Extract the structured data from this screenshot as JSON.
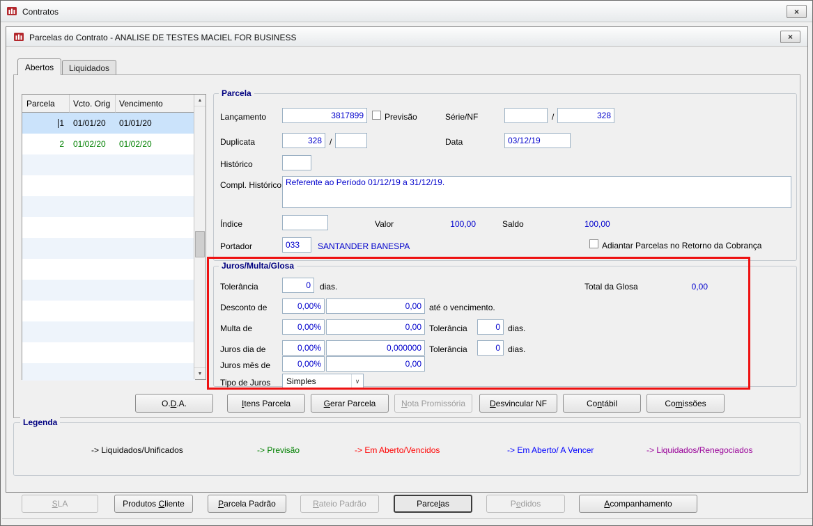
{
  "icons": {
    "close": "×",
    "scroll_up": "▲",
    "scroll_down": "▼",
    "combo_arrow": "∨"
  },
  "colors": {
    "field_value_text": "#0000cc",
    "selected_row_bg": "#cbe3fb",
    "annotation_red": "#ee1111",
    "group_title": "#000080"
  },
  "outer_window": {
    "title": "Contratos"
  },
  "inner_window": {
    "title": "Parcelas do Contrato - ANALISE DE TESTES MACIEL FOR BUSINESS"
  },
  "tabs": [
    {
      "label": "Abertos"
    },
    {
      "label": "Liquidados"
    }
  ],
  "grid": {
    "headers": [
      "Parcela",
      "Vcto. Orig",
      "Vencimento"
    ],
    "rows": [
      {
        "parcela": "1",
        "vcto_orig": "01/01/20",
        "vencimento": "01/01/20",
        "state": "selected"
      },
      {
        "parcela": "2",
        "vcto_orig": "01/02/20",
        "vencimento": "01/02/20",
        "state": "previsao"
      }
    ]
  },
  "parcela_group": {
    "title": "Parcela",
    "lancamento_label": "Lançamento",
    "lancamento_value": "3817899",
    "previsao_label": "Previsão",
    "serie_nf_label": "Série/NF",
    "serie_value": "",
    "slash": "/",
    "nf_value": "328",
    "duplicata_label": "Duplicata",
    "duplicata_value": "328",
    "duplicata_seq_value": "",
    "data_label": "Data",
    "data_value": "03/12/19",
    "historico_label": "Histórico",
    "historico_value": "",
    "compl_historico_label": "Compl. Histórico",
    "compl_historico_value": "Referente ao Período 01/12/19 a 31/12/19.",
    "indice_label": "Índice",
    "indice_value": "",
    "valor_label": "Valor",
    "valor_value": "100,00",
    "saldo_label": "Saldo",
    "saldo_value": "100,00",
    "portador_label": "Portador",
    "portador_code": "033",
    "portador_name": "SANTANDER BANESPA",
    "adiantar_label": "Adiantar Parcelas no Retorno da Cobrança"
  },
  "juros_group": {
    "title": "Juros/Multa/Glosa",
    "tolerancia_label": "Tolerância",
    "tolerancia_value": "0",
    "dias_suffix": "dias.",
    "total_glosa_label": "Total da Glosa",
    "total_glosa_value": "0,00",
    "desconto_label": "Desconto de",
    "desconto_percent": "0,00%",
    "desconto_value": "0,00",
    "desconto_suffix": "até o vencimento.",
    "multa_label": "Multa de",
    "multa_percent": "0,00%",
    "multa_value": "0,00",
    "multa_tolerancia_label": "Tolerância",
    "multa_tolerancia_value": "0",
    "multa_dias_suffix": "dias.",
    "juros_dia_label": "Juros dia de",
    "juros_dia_percent": "0,00%",
    "juros_dia_value": "0,000000",
    "juros_dia_tolerancia_label": "Tolerância",
    "juros_dia_tolerancia_value": "0",
    "juros_dia_dias_suffix": "dias.",
    "juros_mes_label": "Juros mês de",
    "juros_mes_percent": "0,00%",
    "juros_mes_value": "0,00",
    "tipo_juros_label": "Tipo de Juros",
    "tipo_juros_value": "Simples"
  },
  "action_buttons": [
    {
      "pre": "O.",
      "key": "D",
      "post": ".A.",
      "disabled": false
    },
    {
      "pre": "",
      "key": "I",
      "post": "tens Parcela",
      "disabled": false
    },
    {
      "pre": "",
      "key": "G",
      "post": "erar Parcela",
      "disabled": false
    },
    {
      "pre": "",
      "key": "N",
      "post": "ota Promissória",
      "disabled": true
    },
    {
      "pre": "",
      "key": "D",
      "post": "esvincular NF",
      "disabled": false
    },
    {
      "pre": "Co",
      "key": "n",
      "post": "tábil",
      "disabled": false
    },
    {
      "pre": "Co",
      "key": "m",
      "post": "issões",
      "disabled": false
    }
  ],
  "legenda": {
    "title": "Legenda",
    "items": [
      {
        "text": "-> Liquidados/Unificados",
        "color": "#000000"
      },
      {
        "text": "-> Previsão",
        "color": "#008000"
      },
      {
        "text": "-> Em Aberto/Vencidos",
        "color": "#ff0000"
      },
      {
        "text": "-> Em Aberto/ A Vencer",
        "color": "#0000ff"
      },
      {
        "text": "-> Liquidados/Renegociados",
        "color": "#990099"
      }
    ]
  },
  "bottom_buttons": [
    {
      "pre": "",
      "key": "S",
      "post": "LA",
      "disabled": true,
      "active": false
    },
    {
      "pre": "Produtos ",
      "key": "C",
      "post": "liente",
      "disabled": false,
      "active": false
    },
    {
      "pre": "",
      "key": "P",
      "post": "arcela Padrão",
      "disabled": false,
      "active": false
    },
    {
      "pre": "",
      "key": "R",
      "post": "ateio Padrão",
      "disabled": true,
      "active": false
    },
    {
      "pre": "Parce",
      "key": "l",
      "post": "as",
      "disabled": false,
      "active": true
    },
    {
      "pre": "P",
      "key": "e",
      "post": "didos",
      "disabled": true,
      "active": false
    },
    {
      "pre": "",
      "key": "A",
      "post": "companhamento",
      "disabled": false,
      "active": false
    }
  ]
}
